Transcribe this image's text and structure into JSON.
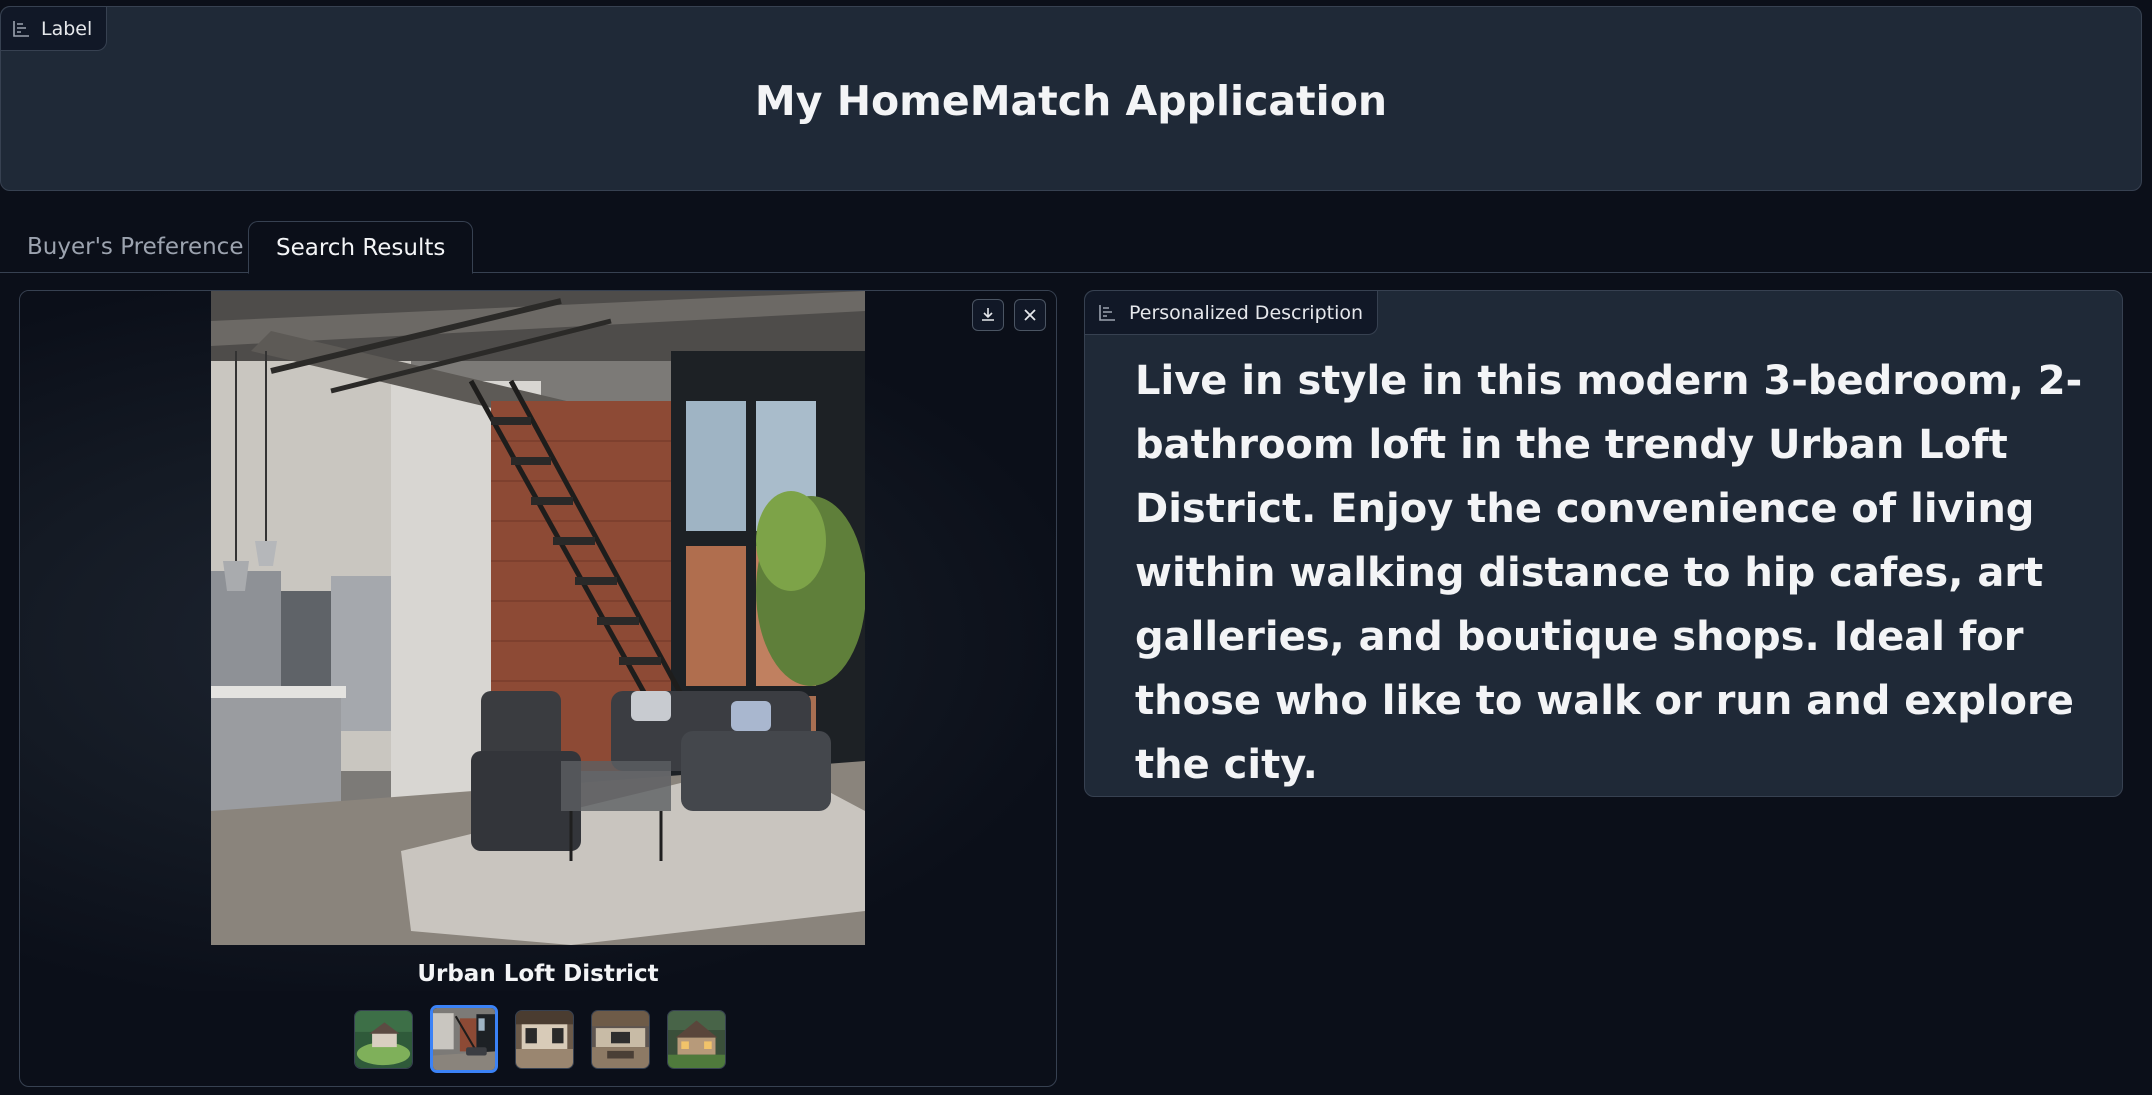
{
  "header": {
    "label_chip": "Label",
    "title": "My HomeMatch Application"
  },
  "tabs": [
    {
      "label": "Buyer's Preference",
      "active": false
    },
    {
      "label": "Search Results",
      "active": true
    }
  ],
  "gallery": {
    "caption": "Urban Loft District",
    "thumbnail_count": 5,
    "selected_index": 1,
    "buttons": {
      "download": "download-icon",
      "close": "close-icon"
    }
  },
  "description": {
    "label_chip": "Personalized Description",
    "text": "Live in style in this modern 3-bedroom, 2-bathroom loft in the trendy Urban Loft District. Enjoy the convenience of living within walking distance to hip cafes, art galleries, and boutique shops. Ideal for those who like to walk or run and explore the city."
  },
  "colors": {
    "background": "#0b0f19",
    "panel": "#1f2937",
    "border": "#374151",
    "accent": "#3b82f6"
  }
}
